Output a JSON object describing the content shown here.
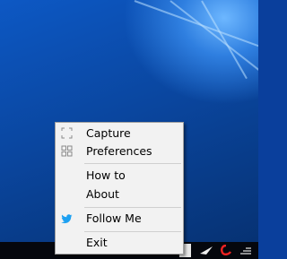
{
  "menu": {
    "items": [
      {
        "label": "Capture",
        "icon": "capture-bracket-icon"
      },
      {
        "label": "Preferences",
        "icon": "grid-icon"
      },
      {
        "label": "How to",
        "icon": null
      },
      {
        "label": "About",
        "icon": null
      },
      {
        "label": "Follow Me",
        "icon": "twitter-bird-icon"
      },
      {
        "label": "Exit",
        "icon": null
      }
    ]
  },
  "colors": {
    "menu_background": "#f2f2f2",
    "desktop_blue": "#0a469f",
    "twitter_blue": "#1da1f2",
    "taskbar": "#05070d"
  }
}
